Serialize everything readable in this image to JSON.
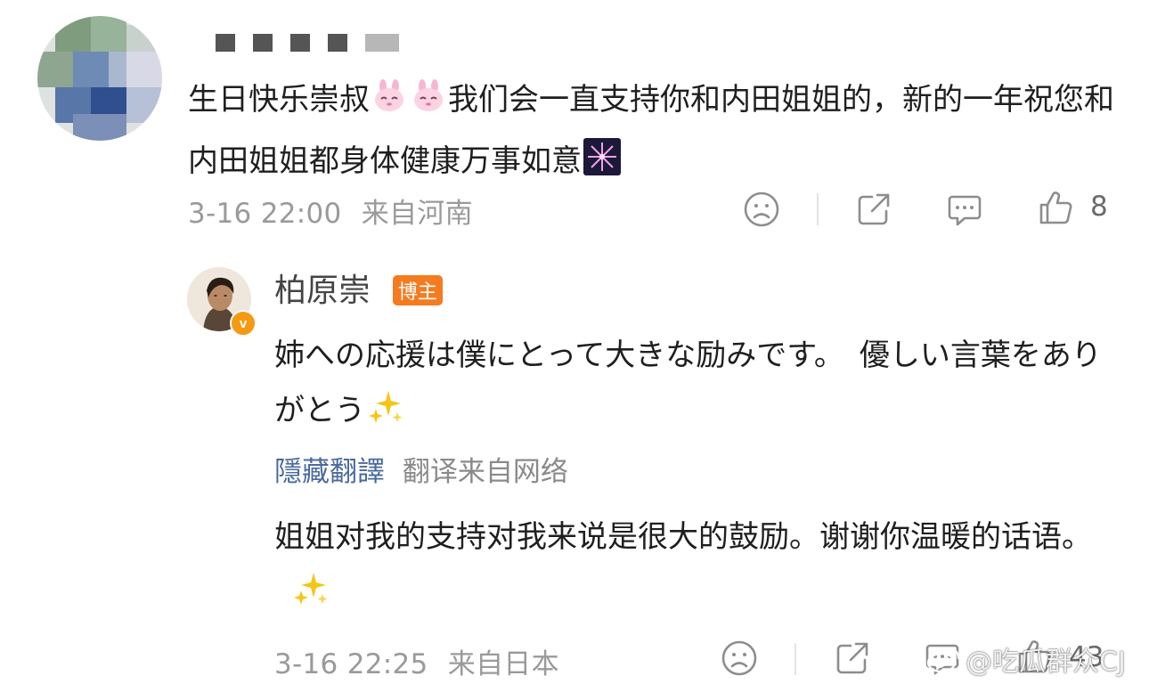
{
  "comment": {
    "text_part1": "生日快乐崇叔",
    "text_part2": "我们会一直支持你和内田姐姐的，新的一年祝您和内田姐姐都身体健康万事如意",
    "emojis": [
      "bunny-emoji",
      "bunny-emoji",
      "fireworks-emoji"
    ],
    "timestamp": "3-16 22:00",
    "location": "来自河南",
    "like_count": "8"
  },
  "reply": {
    "author": "柏原崇",
    "verified_badge": "v",
    "author_badge": "博主",
    "text": "姉への応援は僕にとって大きな励みです。　優しい言葉をありがとう",
    "hide_translation_label": "隱藏翻譯",
    "translation_source": "翻译来自网络",
    "translated_text": "姐姐对我的支持对我来说是很大的鼓励。谢谢你温暖的话语。",
    "timestamp": "3-16 22:25",
    "location": "来自日本",
    "like_count": "43"
  },
  "watermark": {
    "text": "@吃瓜群众CJ"
  },
  "colors": {
    "owner_badge": "#f47b20",
    "verified_badge": "#f49a12",
    "link_blue": "#4a6a9d",
    "meta_gray": "#9a9a9a"
  },
  "icons": [
    "frown-icon",
    "share-icon",
    "comment-icon",
    "thumbs-up-icon",
    "sparkles-icon",
    "weibo-logo-icon"
  ]
}
